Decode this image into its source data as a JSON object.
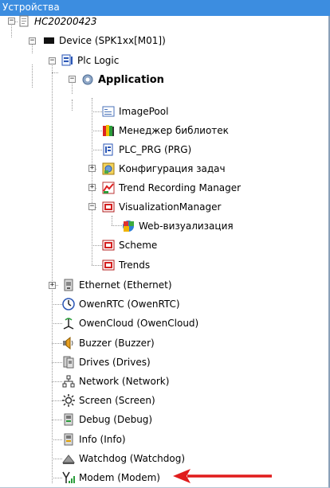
{
  "panel": {
    "title": "Устройства"
  },
  "tree": {
    "project": "HC20200423",
    "device": "Device (SPK1xx[M01])",
    "plc_logic": "Plc Logic",
    "application": "Application",
    "image_pool": "ImagePool",
    "library_manager": "Менеджер библиотек",
    "plc_prg": "PLC_PRG (PRG)",
    "task_config": "Конфигурация задач",
    "trend_manager": "Trend Recording Manager",
    "vis_manager": "VisualizationManager",
    "web_vis": "Web-визуализация",
    "scheme": "Scheme",
    "trends": "Trends",
    "ethernet": "Ethernet (Ethernet)",
    "owenrtc": "OwenRTC (OwenRTC)",
    "owencloud": "OwenCloud (OwenCloud)",
    "buzzer": "Buzzer (Buzzer)",
    "drives": "Drives (Drives)",
    "network": "Network (Network)",
    "screen": "Screen (Screen)",
    "debug": "Debug (Debug)",
    "info": "Info (Info)",
    "watchdog": "Watchdog (Watchdog)",
    "modem": "Modem (Modem)"
  },
  "expander": {
    "collapsed": "+",
    "expanded": "−"
  },
  "annotation": {
    "arrow_color": "#e01c1c"
  }
}
